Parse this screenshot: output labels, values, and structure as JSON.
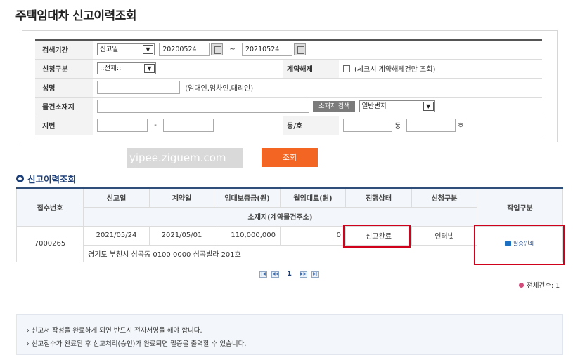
{
  "page": {
    "title": "주택임대차 신고이력조회"
  },
  "search": {
    "period_label": "검색기간",
    "period_type": "신고일",
    "date_from": "20200524",
    "tilde": "~",
    "date_to": "20210524",
    "apply_type_label": "신청구분",
    "apply_type_value": "::전체::",
    "cancel_label": "계약해제",
    "cancel_hint": "(체크시 계약해제건만 조회)",
    "name_label": "성명",
    "name_value": "",
    "name_hint": "(임대인,임차인,대리인)",
    "address_label": "물건소재지",
    "address_value": "",
    "address_button": "소재지 검색",
    "address_type": "일반번지",
    "lot_label": "지번",
    "lot_sep": "-",
    "dongho_label": "동/호",
    "dong_suffix": "동",
    "ho_suffix": "호",
    "submit": "조회"
  },
  "watermark": "yipee.ziguem.com",
  "results": {
    "section_title": "신고이력조회",
    "headers": {
      "receipt_no": "접수번호",
      "report_date": "신고일",
      "contract_date": "계약일",
      "deposit": "임대보증금(원)",
      "monthly_rent": "월임대료(원)",
      "status": "진행상태",
      "apply_type": "신청구분",
      "work_type": "작업구분",
      "location": "소재지(계약물건주소)"
    },
    "rows": [
      {
        "receipt_no": "7000265",
        "report_date": "2021/05/24",
        "contract_date": "2021/05/01",
        "deposit": "110,000,000",
        "monthly_rent": "0",
        "status": "신고완료",
        "apply_type": "인터넷",
        "action": "필증인쇄",
        "address": "경기도 부천시 심곡동 0100 0000 심곡빌라 201호"
      }
    ],
    "pagination": {
      "first": "|◀",
      "prev": "◀◀",
      "current": "1",
      "next": "▶▶",
      "last": "▶|"
    },
    "total_label": "전체건수: 1"
  },
  "notices": [
    "› 신고서 작성을 완료하게 되면 반드시 전자서명을 해야 합니다.",
    "› 신고접수가 완료된 후 신고처리(승인)가 완료되면 필증을 출력할 수 있습니다."
  ]
}
